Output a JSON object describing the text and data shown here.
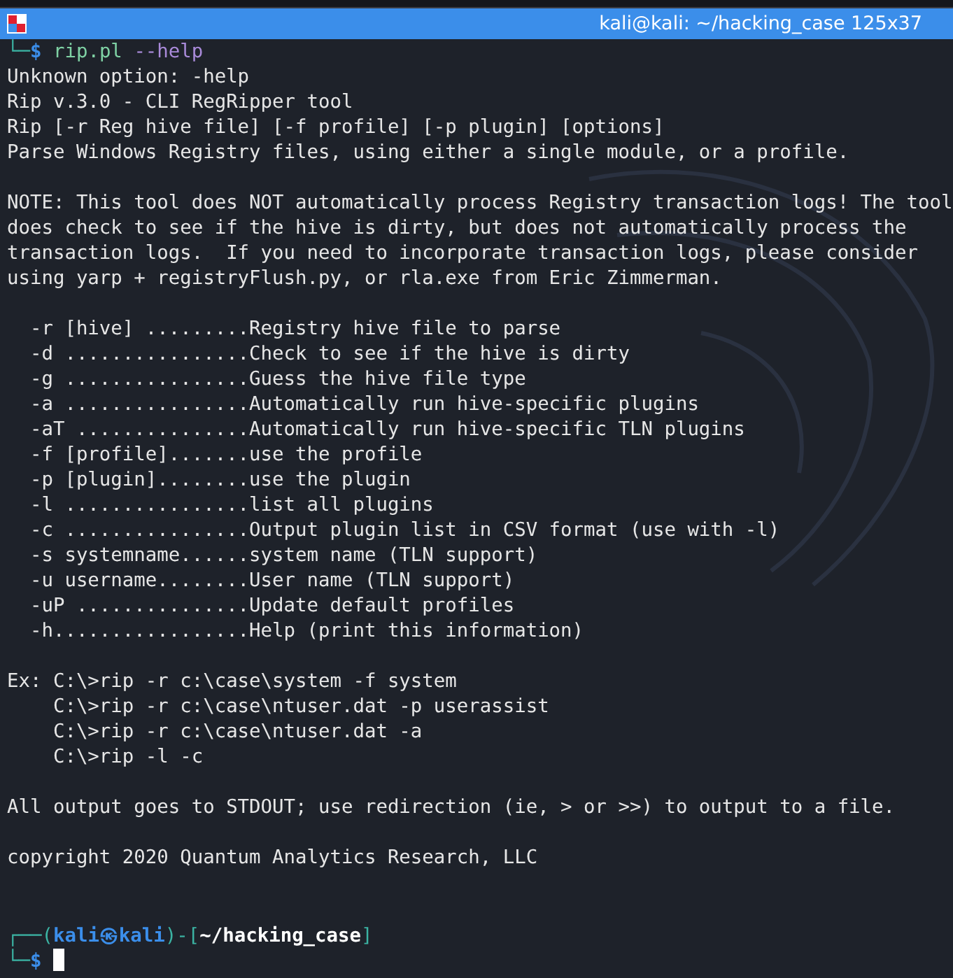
{
  "window": {
    "title": "kali@kali: ~/hacking_case 125x37"
  },
  "command": {
    "corner": "└─",
    "symbol": "$",
    "program": "rip.pl",
    "argument": "--help"
  },
  "output": [
    {
      "lines": [
        "Unknown option: -help",
        "Rip v.3.0 - CLI RegRipper tool",
        "Rip [-r Reg hive file] [-f profile] [-p plugin] [options]",
        "Parse Windows Registry files, using either a single module, or a profile."
      ]
    },
    {
      "lines": [
        "NOTE: This tool does NOT automatically process Registry transaction logs! The tool",
        "does check to see if the hive is dirty, but does not automatically process the",
        "transaction logs.  If you need to incorporate transaction logs, please consider",
        "using yarp + registryFlush.py, or rla.exe from Eric Zimmerman."
      ]
    },
    {
      "lines": [
        "  -r [hive] .........Registry hive file to parse",
        "  -d ................Check to see if the hive is dirty",
        "  -g ................Guess the hive file type",
        "  -a ................Automatically run hive-specific plugins",
        "  -aT ...............Automatically run hive-specific TLN plugins",
        "  -f [profile].......use the profile",
        "  -p [plugin]........use the plugin",
        "  -l ................list all plugins",
        "  -c ................Output plugin list in CSV format (use with -l)",
        "  -s systemname......system name (TLN support)",
        "  -u username........User name (TLN support)",
        "  -uP ...............Update default profiles",
        "  -h.................Help (print this information)"
      ]
    },
    {
      "lines": [
        "Ex: C:\\>rip -r c:\\case\\system -f system",
        "    C:\\>rip -r c:\\case\\ntuser.dat -p userassist",
        "    C:\\>rip -r c:\\case\\ntuser.dat -a",
        "    C:\\>rip -l -c"
      ]
    },
    {
      "lines": [
        "All output goes to STDOUT; use redirection (ie, > or >>) to output to a file."
      ]
    },
    {
      "lines": [
        "copyright 2020 Quantum Analytics Research, LLC"
      ]
    }
  ],
  "prompt": {
    "open": "┌──(",
    "user": "kali㉿kali",
    "mid": ")-[",
    "path": "~/hacking_case",
    "close": "]",
    "corner": "└─",
    "symbol": "$"
  }
}
